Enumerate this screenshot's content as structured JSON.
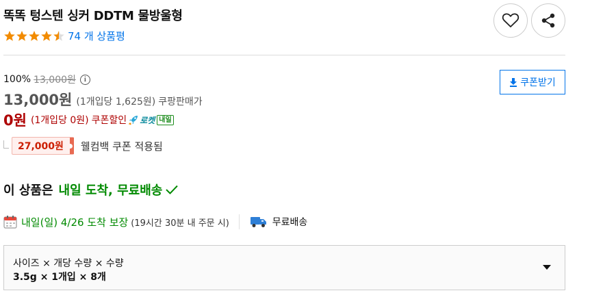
{
  "product": {
    "title": "똑똑 텅스텐 싱커 DDTM 물방울형",
    "rating_stars": 4.5,
    "review_count_label": "74 개 상품평"
  },
  "actions": {
    "wishlist_icon": "heart-icon",
    "share_icon": "share-icon"
  },
  "price": {
    "discount_rate": "100%",
    "original_price": "13,000원",
    "sale_price": "13,000원",
    "sale_unit_price": "(1개입당 1,625원)",
    "seller_label": "쿠팡판매가",
    "coupon_price": "0원",
    "coupon_unit_price": "(1개입당 0원)",
    "coupon_discount_label": "쿠폰할인",
    "rocket_label": "로켓",
    "rocket_badge": "내일",
    "welcome_coupon_amount": "27,000원",
    "welcome_coupon_text": "웰컴백 쿠폰 적용됨",
    "coupon_button_label": "쿠폰받기"
  },
  "delivery": {
    "headline_prefix": "이 상품은",
    "headline_highlight": "내일 도착, 무료배송",
    "date_label": "내일(일) 4/26 도착 보장",
    "cutoff_label": "(19시간 30분 내 주문 시)",
    "shipping_label": "무료배송"
  },
  "option": {
    "label": "사이즈 × 개당 수량 × 수량",
    "value": "3.5g × 1개입 × 8개"
  },
  "colors": {
    "link_blue": "#0073e9",
    "coupon_red": "#ae0000",
    "delivery_green": "#008a00",
    "star_orange": "#f28b00"
  }
}
